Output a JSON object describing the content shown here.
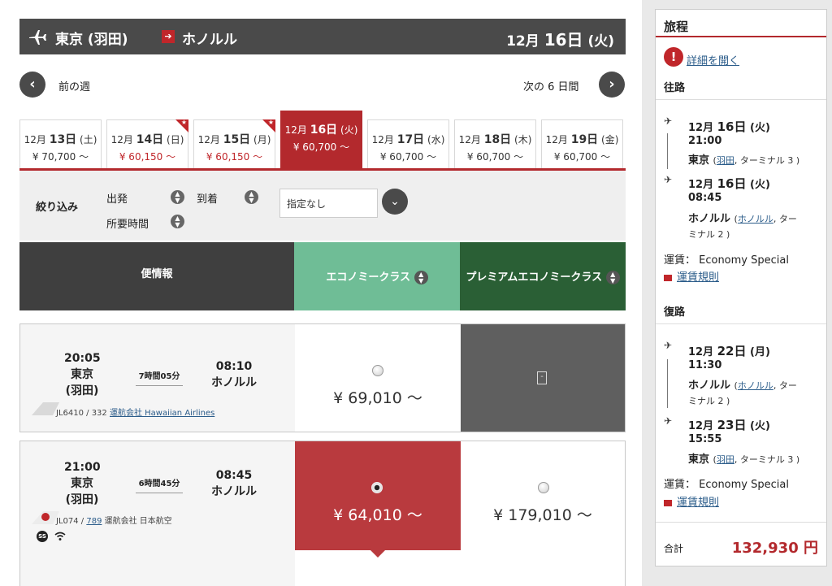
{
  "header": {
    "origin": "東京 (羽田)",
    "destination": "ホノルル",
    "date_month": "12月",
    "date_day": "16日",
    "date_weekday": "(火)"
  },
  "week_nav": {
    "prev": "前の週",
    "next": "次の 6 日間"
  },
  "date_tabs": [
    {
      "month": "12月",
      "day": "13日",
      "weekday": "(土)",
      "price": "¥ 70,700 ～",
      "sale": false,
      "active": false
    },
    {
      "month": "12月",
      "day": "14日",
      "weekday": "(日)",
      "price": "¥ 60,150 ～",
      "sale": true,
      "active": false
    },
    {
      "month": "12月",
      "day": "15日",
      "weekday": "(月)",
      "price": "¥ 60,150 ～",
      "sale": true,
      "active": false
    },
    {
      "month": "12月",
      "day": "16日",
      "weekday": "(火)",
      "price": "¥ 60,700 ～",
      "sale": false,
      "active": true
    },
    {
      "month": "12月",
      "day": "17日",
      "weekday": "(水)",
      "price": "¥ 60,700 ～",
      "sale": false,
      "active": false
    },
    {
      "month": "12月",
      "day": "18日",
      "weekday": "(木)",
      "price": "¥ 60,700 ～",
      "sale": false,
      "active": false
    },
    {
      "month": "12月",
      "day": "19日",
      "weekday": "(金)",
      "price": "¥ 60,700 ～",
      "sale": false,
      "active": false
    }
  ],
  "filter": {
    "label": "絞り込み",
    "departure": "出発",
    "arrival": "到着",
    "duration": "所要時間",
    "select_value": "指定なし"
  },
  "table_header": {
    "info": "便情報",
    "economy": "エコノミークラス",
    "premium": "プレミアムエコノミークラス"
  },
  "flights": [
    {
      "dep_time": "20:05",
      "dep_city": "東京",
      "dep_airport": "(羽田)",
      "duration": "7時間05分",
      "arr_time": "08:10",
      "arr_city": "ホノルル",
      "flight_no": "JL6410 / 332",
      "operator_link": "運航会社 Hawaiian Airlines",
      "economy_price": "¥ 69,010 ～",
      "premium_placeholder": "-"
    },
    {
      "dep_time": "21:00",
      "dep_city": "東京",
      "dep_airport": "(羽田)",
      "duration": "6時間45分",
      "arr_time": "08:45",
      "arr_city": "ホノルル",
      "flight_no_prefix": "JL074 /",
      "aircraft_link": "789",
      "operator": "運航会社 日本航空",
      "economy_price": "¥ 64,010 ～",
      "premium_price": "¥ 179,010 ～",
      "badge": "SS"
    }
  ],
  "sidebar": {
    "title": "旅程",
    "details_link": "詳細を開く",
    "outbound_label": "往路",
    "outbound": {
      "dep_month": "12月",
      "dep_day": "16日",
      "dep_weekday": "(火)",
      "dep_time": "21:00",
      "dep_city": "東京",
      "dep_airport_link": "羽田",
      "dep_terminal": ", ターミナル 3 )",
      "arr_month": "12月",
      "arr_day": "16日",
      "arr_weekday": "(火)",
      "arr_time": "08:45",
      "arr_city": "ホノルル",
      "arr_airport_link": "ホノルル",
      "arr_terminal_1": ", ター",
      "arr_terminal_2": "ミナル 2 )"
    },
    "outbound_fare": "運賃： Economy Special",
    "outbound_rule": "運賃規則",
    "return_label": "復路",
    "return": {
      "dep_month": "12月",
      "dep_day": "22日",
      "dep_weekday": "(月)",
      "dep_time": "11:30",
      "dep_city": "ホノルル",
      "dep_airport_link": "ホノルル",
      "dep_terminal_1": ", ター",
      "dep_terminal_2": "ミナル 2 )",
      "arr_month": "12月",
      "arr_day": "23日",
      "arr_weekday": "(火)",
      "arr_time": "15:55",
      "arr_city": "東京",
      "arr_airport_link": "羽田",
      "arr_terminal": ", ターミナル 3 )"
    },
    "return_fare": "運賃： Economy Special",
    "return_rule": "運賃規則",
    "total_label": "合計",
    "total_value": "132,930 円"
  },
  "colors": {
    "accent_red": "#b3292d",
    "economy_green": "#6fbd96",
    "premium_green": "#2a5f35",
    "header_gray": "#4a4a4a"
  }
}
